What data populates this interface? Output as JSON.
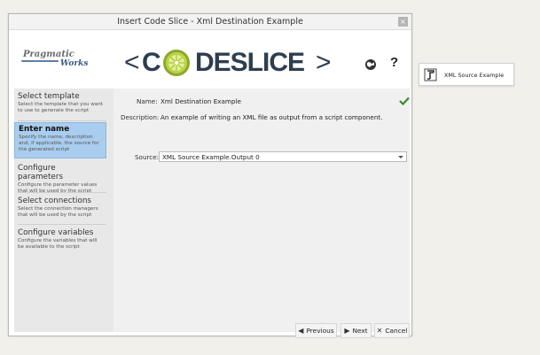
{
  "window": {
    "title": "Insert Code Slice - Xml Destination Example",
    "close_glyph": "×"
  },
  "header": {
    "brand_line1": "Pragmatic",
    "brand_line2": "Works",
    "logo_left_bracket": "<",
    "logo_text": "DESLICE",
    "logo_first_letter": "C",
    "logo_lime_letter": "O",
    "logo_right_bracket": ">",
    "help_glyph": "?"
  },
  "steps": [
    {
      "title": "Select template",
      "desc": "Select the template that you want to use to generate the script",
      "active": false
    },
    {
      "title": "Enter name",
      "desc": "Specify the name, description and, if applicable, the source for the generated script",
      "active": true
    },
    {
      "title": "Configure parameters",
      "desc": "Configure the parameter values that will be used by the script",
      "active": false
    },
    {
      "title": "Select connections",
      "desc": "Select the connection managers that will be used by the script",
      "active": false
    },
    {
      "title": "Configure variables",
      "desc": "Configure the variables that will be available to the script",
      "active": false
    }
  ],
  "form": {
    "name_label": "Name:",
    "name_value": "Xml Destination Example",
    "description_label": "Description:",
    "description_value": "An example of writing an XML file as output from a script component.",
    "source_label": "Source:",
    "source_value": "XML Source Example.Output 0"
  },
  "buttons": {
    "previous": "Previous",
    "next": "Next",
    "cancel": "Cancel"
  },
  "node": {
    "label": "XML Source Example"
  },
  "colors": {
    "accent": "#a9cdee",
    "check": "#3c8a2e",
    "logo_text": "#2d3e4f",
    "lime": "#b9d44a"
  }
}
